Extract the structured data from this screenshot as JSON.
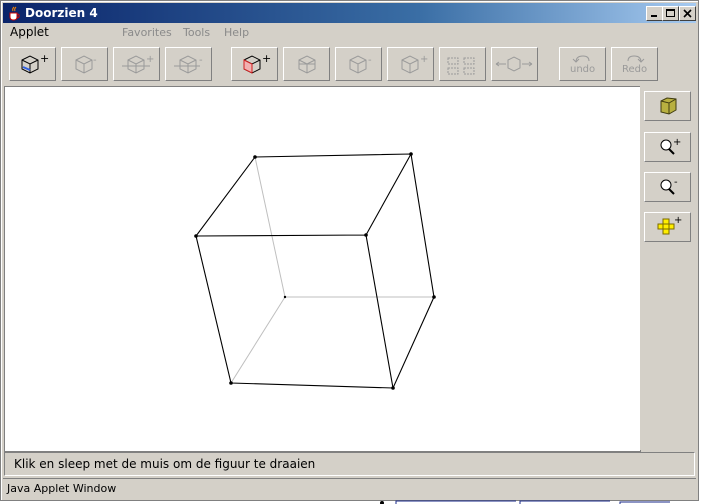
{
  "window": {
    "title": "Doorzien 4"
  },
  "menu": {
    "applet": "Applet",
    "favorites": "Favorites",
    "tools": "Tools",
    "help": "Help"
  },
  "toolbar": {
    "undo_label": "undo",
    "redo_label": "Redo"
  },
  "status": {
    "message": "Klik en sleep met de muis om de figuur te draaien"
  },
  "applet_warning": "Java Applet Window",
  "colors": {
    "title_start": "#0a246a",
    "title_end": "#a6caf0",
    "chrome": "#d4d0c8",
    "cube_icon": "#b8b040",
    "plus_icon": "#ffee00"
  }
}
